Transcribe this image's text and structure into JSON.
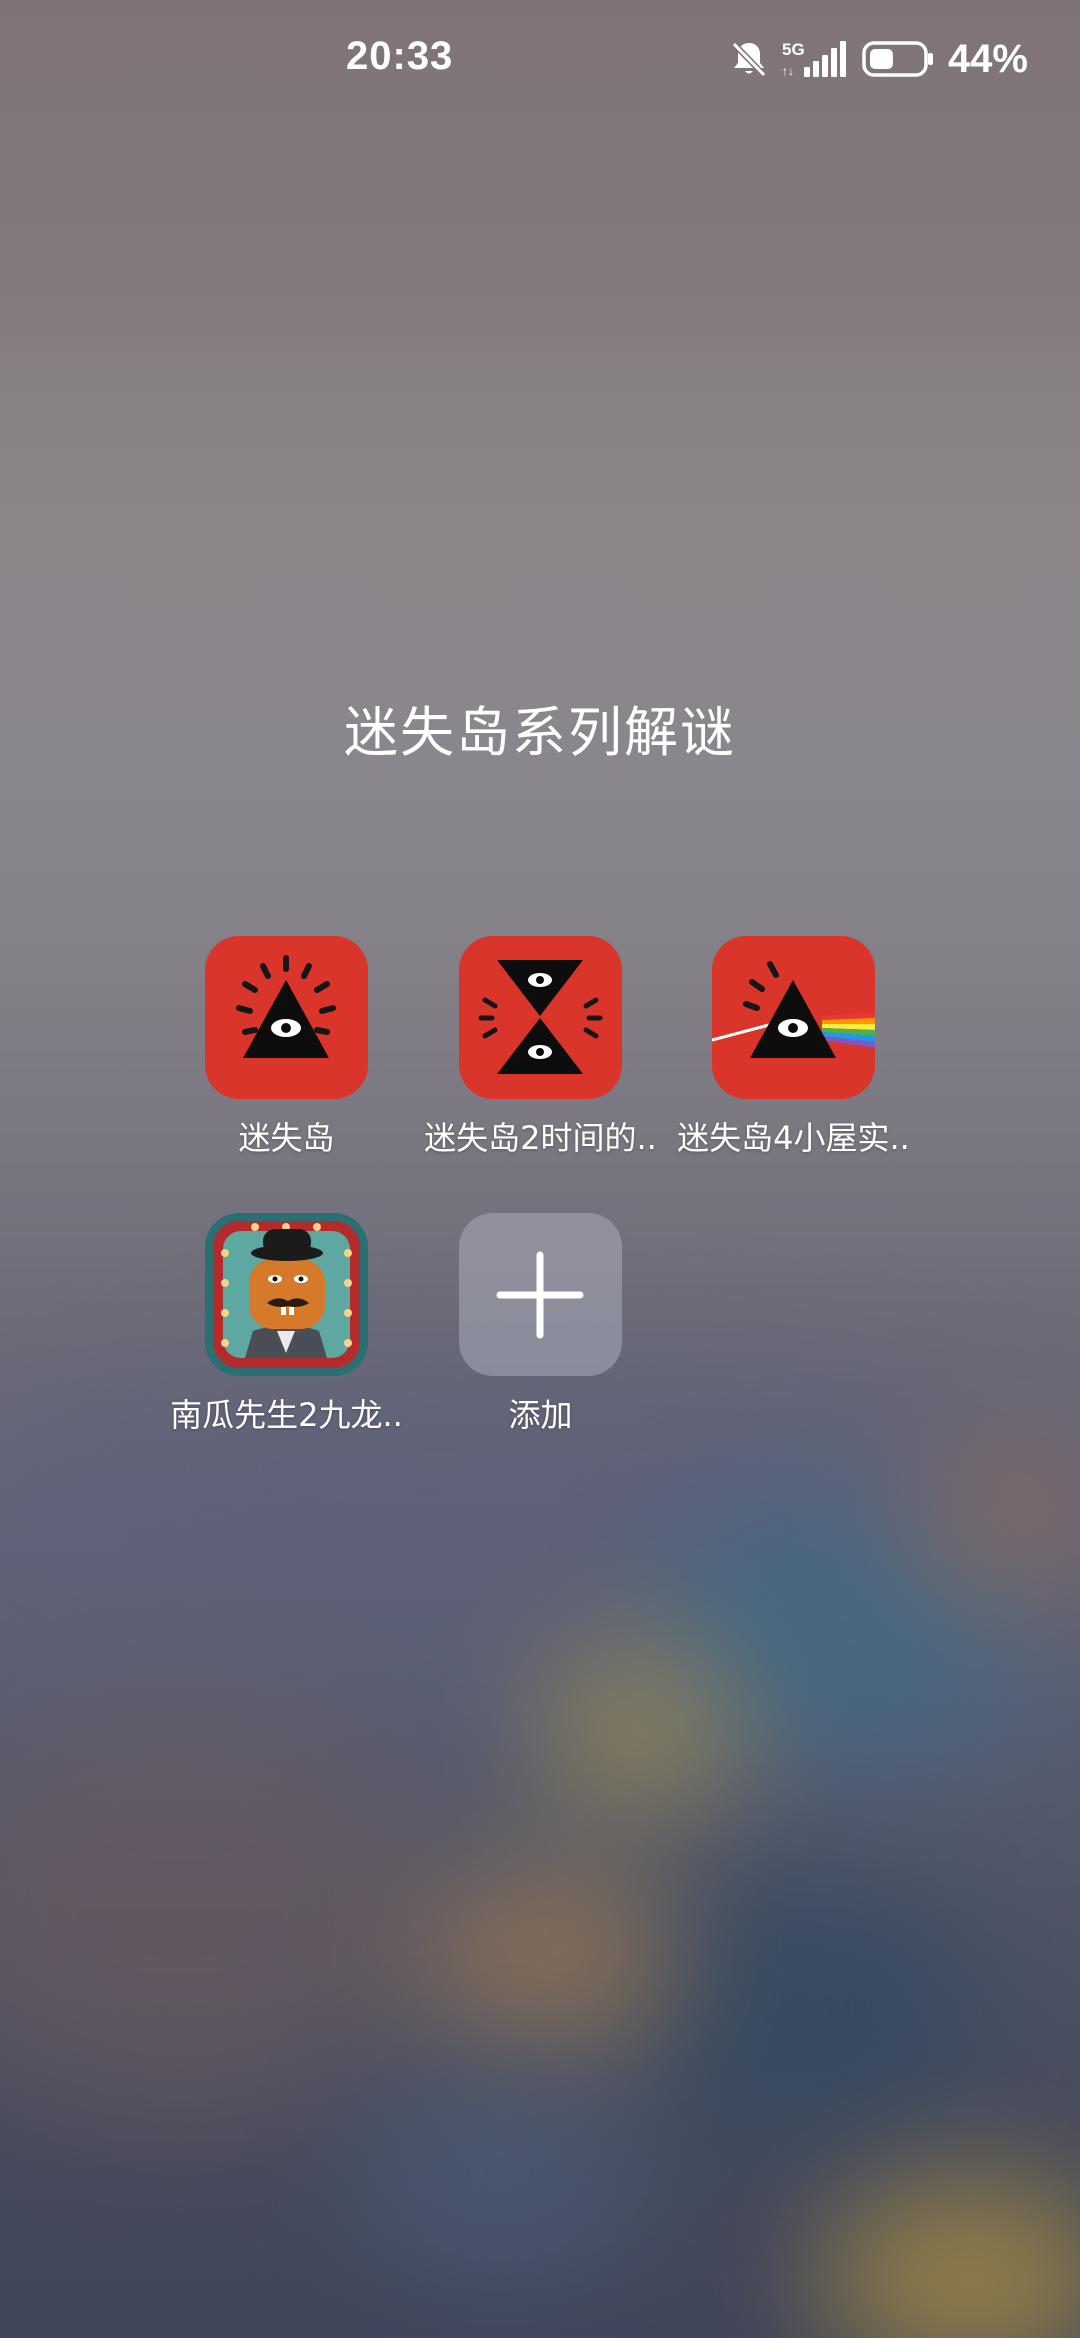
{
  "status_bar": {
    "time": "20:33",
    "network": "5G",
    "battery_percent": "44%",
    "battery_level": 0.44,
    "icons": [
      "bell-off-icon",
      "signal-icon",
      "battery-icon"
    ]
  },
  "folder": {
    "title": "迷失岛系列解谜",
    "apps": [
      {
        "label": "迷失岛",
        "icon": "lost-island-icon"
      },
      {
        "label": "迷失岛2时间的..",
        "icon": "lost-island-2-icon"
      },
      {
        "label": "迷失岛4小屋实..",
        "icon": "lost-island-4-icon"
      },
      {
        "label": "南瓜先生2九龙..",
        "icon": "mr-pumpkin-2-icon"
      },
      {
        "label": "添加",
        "icon": "add-icon"
      }
    ]
  },
  "colors": {
    "app_red": "#d9352a",
    "add_tile": "#a5a7b4"
  }
}
